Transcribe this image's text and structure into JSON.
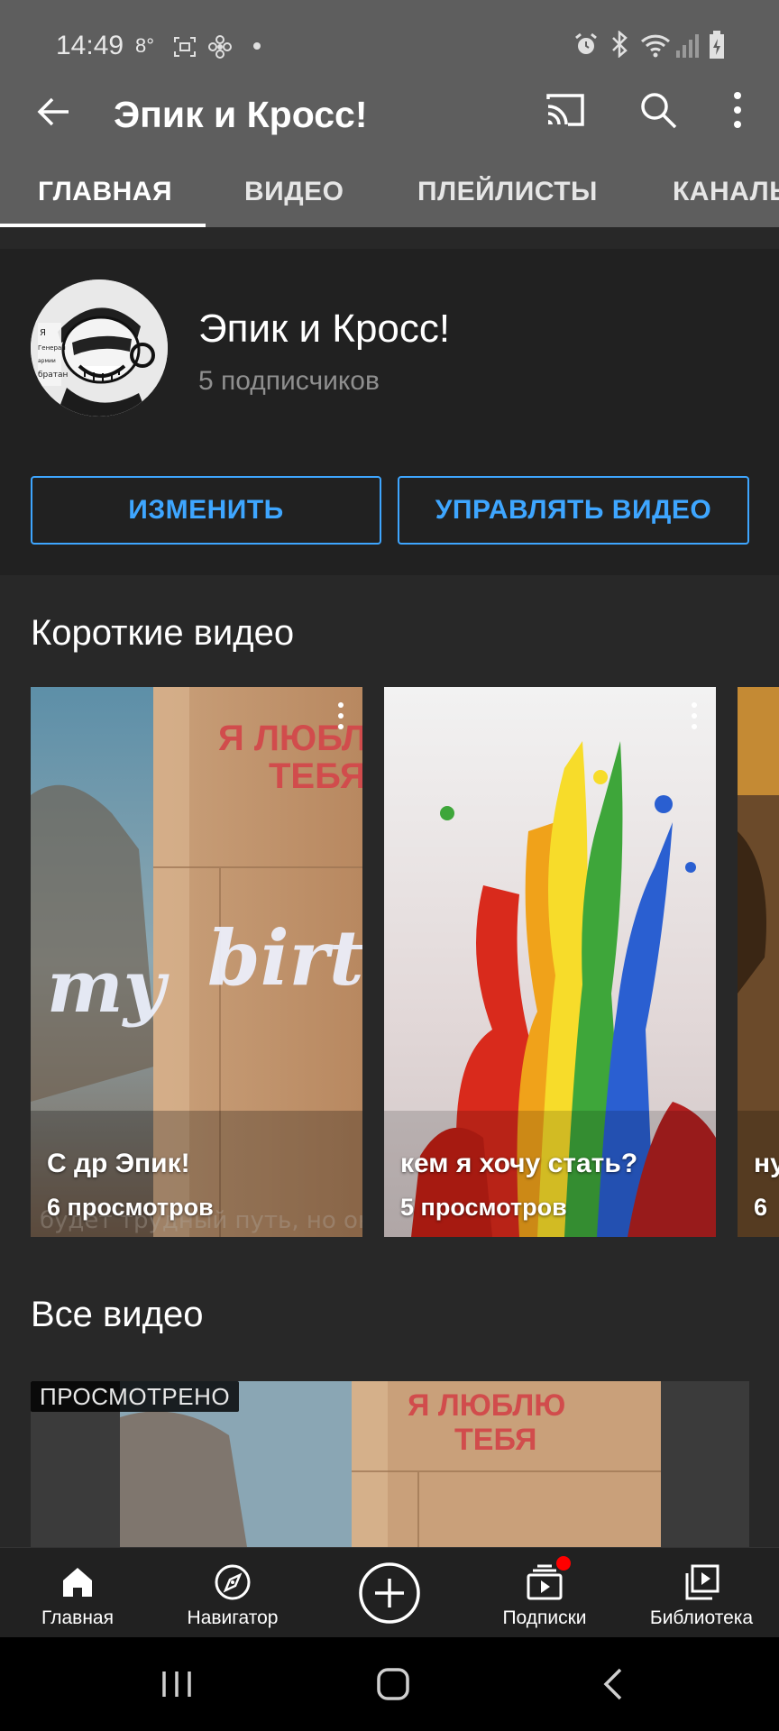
{
  "status_bar": {
    "time": "14:49",
    "temperature": "8°",
    "icons": [
      "screenshot-icon",
      "fan-icon",
      "notification-dot-icon",
      "alarm-icon",
      "bluetooth-icon",
      "wifi-icon",
      "signal-icon",
      "battery-icon"
    ]
  },
  "app_bar": {
    "title": "Эпик и Кросс!",
    "icons": [
      "back-arrow-icon",
      "cast-icon",
      "search-icon",
      "more-vert-icon"
    ],
    "tabs": [
      {
        "label": "ГЛАВНАЯ",
        "active": true
      },
      {
        "label": "ВИДЕО",
        "active": false
      },
      {
        "label": "ПЛЕЙЛИСТЫ",
        "active": false
      },
      {
        "label": "КАНАЛЫ",
        "active": false
      }
    ]
  },
  "channel": {
    "name": "Эпик и Кросс!",
    "subscribers": "5 подписчиков",
    "edit_label": "ИЗМЕНИТЬ",
    "manage_label": "УПРАВЛЯТЬ ВИДЕО"
  },
  "shorts": {
    "title": "Короткие видео",
    "items": [
      {
        "title": "С др Эпик!",
        "views": "6 просмотров",
        "thumb_text_1": "Я ЛЮБЛЮ",
        "thumb_text_2": "ТЕБЯ",
        "thumb_text_3": "my",
        "thumb_text_4": "birt",
        "thumb_text_5": "будет трудный путь, но он"
      },
      {
        "title": "кем я хочу стать?",
        "views": "5 просмотров"
      },
      {
        "title": "ну",
        "views": "6"
      }
    ]
  },
  "all_videos": {
    "title": "Все видео",
    "watched_badge": "ПРОСМОТРЕНО",
    "thumb_text_1": "Я ЛЮБЛЮ",
    "thumb_text_2": "ТЕБЯ"
  },
  "bottom_nav": [
    {
      "label": "Главная",
      "icon": "home-icon"
    },
    {
      "label": "Навигатор",
      "icon": "explore-icon"
    },
    {
      "label": "",
      "icon": "create-plus-icon"
    },
    {
      "label": "Подписки",
      "icon": "subscriptions-icon"
    },
    {
      "label": "Библиотека",
      "icon": "library-icon"
    }
  ],
  "colors": {
    "accent_blue": "#3ea6ff",
    "notification_red": "#ff0000",
    "appbar_gray": "#5e5e5e",
    "background": "#282828"
  }
}
